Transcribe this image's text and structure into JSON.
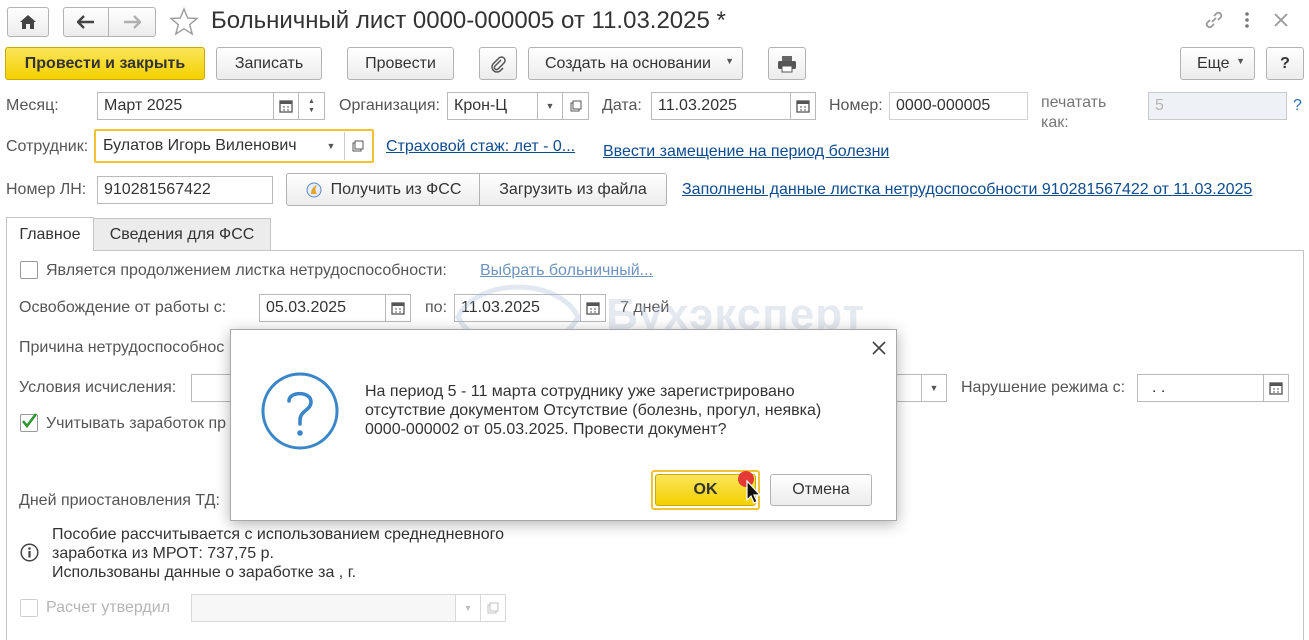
{
  "window": {
    "title": "Больничный лист 0000-000005 от 11.03.2025 *"
  },
  "toolbar": {
    "post_close": "Провести и закрыть",
    "save": "Записать",
    "post": "Провести",
    "create_based": "Создать на основании",
    "more": "Еще",
    "help": "?"
  },
  "form": {
    "month_label": "Месяц:",
    "month_value": "Март 2025",
    "org_label": "Организация:",
    "org_value": "Крон-Ц",
    "date_label": "Дата:",
    "date_value": "11.03.2025",
    "number_label": "Номер:",
    "number_value": "0000-000005",
    "print_as_label_1": "печатать",
    "print_as_label_2": "как:",
    "print_as_value": "5",
    "print_help": "?",
    "employee_label": "Сотрудник:",
    "employee_value": "Булатов Игорь Виленович",
    "insurance_link": "Страховой стаж: лет - 0...",
    "replacement_link": "Ввести замещение на период болезни",
    "ln_label": "Номер ЛН:",
    "ln_value": "910281567422",
    "get_fss": "Получить из ФСС",
    "load_file": "Загрузить из файла",
    "filled_link": "Заполнены данные листка нетрудоспособности 910281567422 от 11.03.2025"
  },
  "tabs": [
    {
      "label": "Главное"
    },
    {
      "label": "Сведения для ФСС"
    }
  ],
  "main": {
    "continuation_label": "Является продолжением листка нетрудоспособности:",
    "choose_sick_link": "Выбрать больничный...",
    "release_label": "Освобождение от работы с:",
    "release_from": "05.03.2025",
    "release_to_label": "по:",
    "release_to": "11.03.2025",
    "days": "7 дней",
    "reason_label": "Причина нетрудоспособнос",
    "conditions_label": "Условия исчисления:",
    "violation_label": "Нарушение режима с:",
    "violation_value": ".  .",
    "earnings_label": "Учитывать заработок пр",
    "suspend_label": "Дней приостановления ТД:",
    "info_1": "Пособие рассчитывается с использованием среднедневного",
    "info_2": "заработка из МРОТ: 737,75 р.",
    "info_3": "Использованы данные о заработке за  ,    г.",
    "approved_label": "Расчет утвердил"
  },
  "dialog": {
    "message_1": "На период 5 - 11 марта сотруднику уже зарегистрировано",
    "message_2": "отсутствие документом Отсутствие (болезнь, прогул, неявка)",
    "message_3": "0000-000002 от 05.03.2025. Провести документ?",
    "ok": "OK",
    "cancel": "Отмена"
  },
  "watermark": "Бухэксперт"
}
